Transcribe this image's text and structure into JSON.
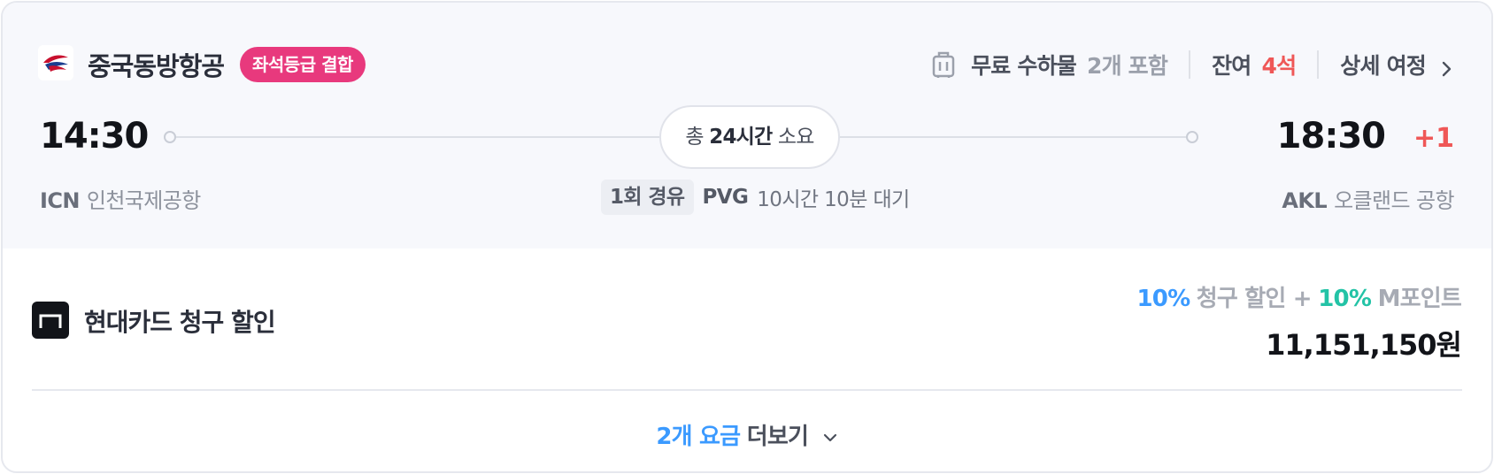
{
  "airline": {
    "name": "중국동방항공",
    "badge": "좌석등급 결합"
  },
  "meta": {
    "baggage_label": "무료 수하물",
    "baggage_value": "2개 포함",
    "seats_label": "잔여",
    "seats_value": "4석",
    "details_link": "상세 여정"
  },
  "departure": {
    "time": "14:30",
    "code": "ICN",
    "airport": "인천국제공항"
  },
  "arrival": {
    "time": "18:30",
    "day_offset": "+1",
    "code": "AKL",
    "airport": "오클랜드 공항"
  },
  "duration": {
    "prefix": "총",
    "value": "24시간",
    "suffix": "소요"
  },
  "stopover": {
    "count": "1회 경유",
    "airport": "PVG",
    "wait": "10시간 10분 대기"
  },
  "fare": {
    "card_name": "현대카드 청구 할인",
    "discount_pct": "10%",
    "discount_label": "청구 할인 +",
    "points_pct": "10%",
    "points_label": "M포인트",
    "price": "11,151,150원"
  },
  "more_fares": {
    "count": "2개 요금",
    "label": "더보기"
  },
  "colors": {
    "badge": "#e8397d",
    "accent_blue": "#3b9aff",
    "accent_teal": "#23c3a6",
    "alert_red": "#ef5757"
  },
  "icons": [
    "airline-logo-icon",
    "luggage-icon",
    "chevron-right-icon",
    "card-brand-icon",
    "chevron-down-icon"
  ]
}
